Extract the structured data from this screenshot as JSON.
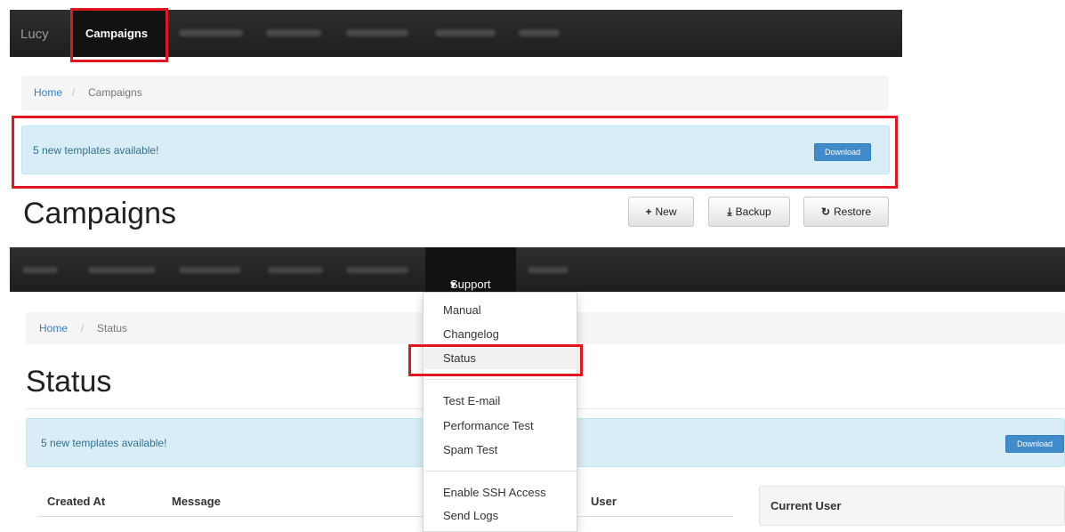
{
  "top_panel": {
    "navbar": {
      "brand": "Lucy",
      "active_item": "Campaigns"
    },
    "breadcrumb": {
      "home": "Home",
      "separator": "/",
      "current": "Campaigns"
    },
    "alert": {
      "message": "5 new templates available!",
      "download_label": "Download"
    },
    "page_title": "Campaigns",
    "toolbar": {
      "new_icon": "+",
      "new_label": "New",
      "backup_icon": "⤓",
      "backup_label": "Backup",
      "restore_icon": "↻",
      "restore_label": "Restore"
    }
  },
  "bottom_panel": {
    "navbar": {
      "active_item": "Support",
      "caret": "▾"
    },
    "dropdown": {
      "items": [
        "Manual",
        "Changelog",
        "Status",
        "Test E-mail",
        "Performance Test",
        "Spam Test",
        "Enable SSH Access",
        "Send Logs"
      ]
    },
    "breadcrumb": {
      "home": "Home",
      "separator": "/",
      "current": "Status"
    },
    "page_title": "Status",
    "alert": {
      "message": "5 new templates available!",
      "download_label": "Download"
    },
    "table": {
      "headers": [
        "Created At",
        "Message",
        "User"
      ]
    },
    "side_card": {
      "title": "Current User"
    }
  },
  "colors": {
    "highlight_box": "#e0171f",
    "navbar_bg": "#222222",
    "alert_bg": "#d9edf7",
    "link": "#3a7fc1",
    "primary_button": "#428bca"
  }
}
